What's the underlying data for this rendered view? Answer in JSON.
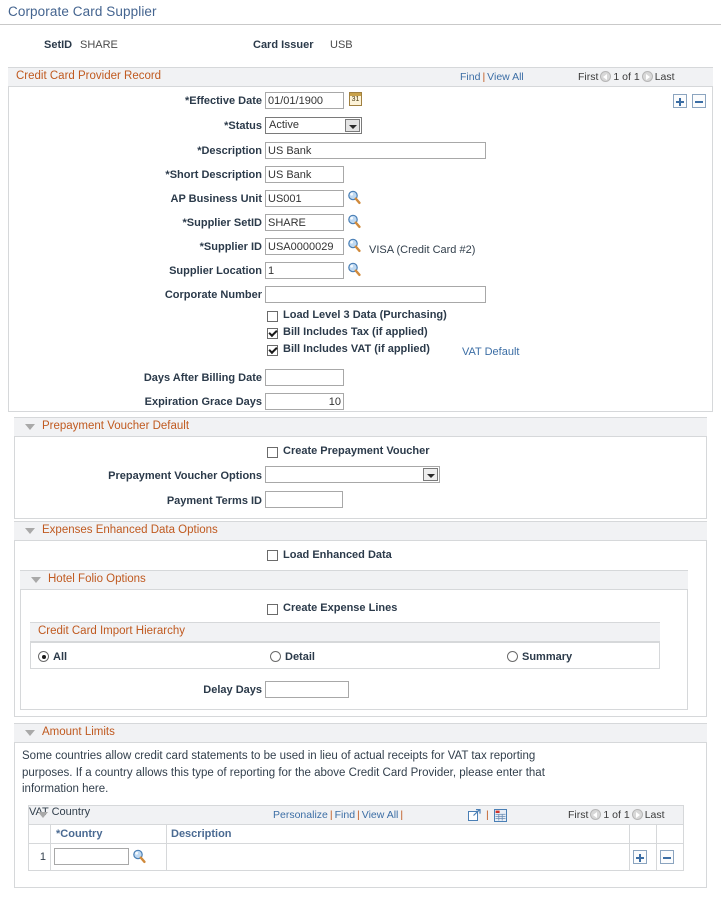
{
  "page": {
    "title": "Corporate Card Supplier"
  },
  "key_fields": {
    "setid_label": "SetID",
    "setid_value": "SHARE",
    "card_issuer_label": "Card Issuer",
    "card_issuer_value": "USB"
  },
  "provider_record": {
    "title": "Credit Card Provider Record",
    "find_label": "Find",
    "view_all_label": "View All",
    "first_label": "First",
    "page_indicator": "1 of 1",
    "last_label": "Last",
    "fields": {
      "effective_date_label": "*Effective Date",
      "effective_date_value": "01/01/1900",
      "status_label": "*Status",
      "status_value": "Active",
      "description_label": "*Description",
      "description_value": "US Bank",
      "short_description_label": "*Short Description",
      "short_description_value": "US Bank",
      "ap_business_unit_label": "AP Business Unit",
      "ap_business_unit_value": "US001",
      "supplier_setid_label": "*Supplier SetID",
      "supplier_setid_value": "SHARE",
      "supplier_id_label": "*Supplier ID",
      "supplier_id_value": "USA0000029",
      "supplier_id_description": "VISA (Credit Card #2)",
      "supplier_location_label": "Supplier Location",
      "supplier_location_value": "1",
      "corporate_number_label": "Corporate Number",
      "corporate_number_value": "",
      "days_after_billing_label": "Days After Billing Date",
      "days_after_billing_value": "",
      "expiration_grace_label": "Expiration Grace Days",
      "expiration_grace_value": "10"
    },
    "checkboxes": {
      "load_level3_label": "Load Level 3 Data (Purchasing)",
      "bill_includes_tax_label": "Bill Includes Tax (if applied)",
      "bill_includes_vat_label": "Bill Includes VAT (if applied)"
    },
    "vat_default_link": "VAT Default",
    "calendar_icon_day": "31"
  },
  "prepayment_voucher": {
    "title": "Prepayment Voucher Default",
    "create_prepayment_label": "Create Prepayment Voucher",
    "options_label": "Prepayment Voucher Options",
    "options_value": "",
    "payment_terms_label": "Payment Terms ID",
    "payment_terms_value": ""
  },
  "expenses_enhanced": {
    "title": "Expenses Enhanced Data Options",
    "load_enhanced_label": "Load Enhanced Data"
  },
  "hotel_folio": {
    "title": "Hotel Folio Options",
    "create_expense_lines_label": "Create Expense Lines",
    "hierarchy_title": "Credit Card Import Hierarchy",
    "radio_all": "All",
    "radio_detail": "Detail",
    "radio_summary": "Summary",
    "delay_days_label": "Delay Days",
    "delay_days_value": ""
  },
  "amount_limits": {
    "title": "Amount Limits",
    "description": "Some countries allow credit card statements to be used in lieu of actual receipts for VAT tax reporting purposes. If a country allows this type of reporting for the above Credit Card Provider, please enter that information here."
  },
  "vat_country_grid": {
    "title": "VAT Country",
    "personalize_label": "Personalize",
    "find_label": "Find",
    "view_all_label": "View All",
    "first_label": "First",
    "page_indicator": "1 of 1",
    "last_label": "Last",
    "columns": [
      "*Country",
      "Description"
    ],
    "rows": [
      {
        "num": "1",
        "country": "",
        "description": ""
      }
    ]
  },
  "colors": {
    "title_blue": "#44648f",
    "section_orange": "#c05a20",
    "link_blue": "#3c6ea5",
    "header_grey": "#f1f2f4",
    "border_grey": "#d6d8da",
    "label_dark": "#2b3a4a",
    "column_header_blue": "#4a6a92"
  }
}
